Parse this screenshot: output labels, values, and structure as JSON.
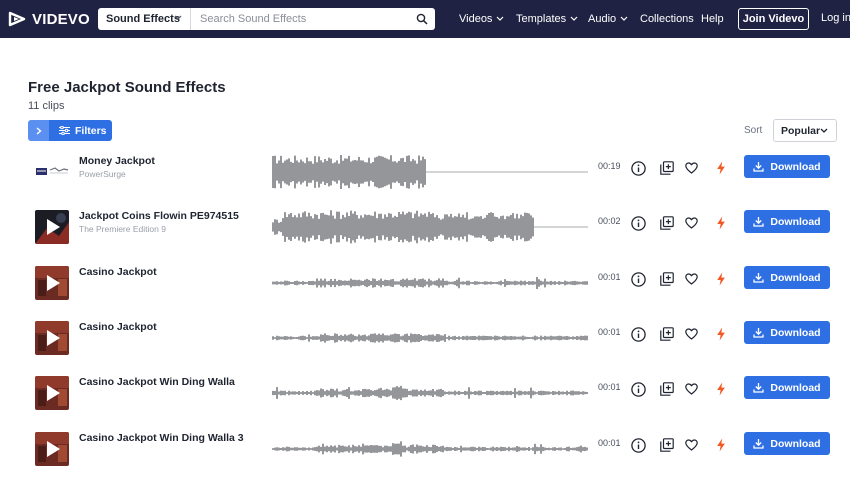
{
  "header": {
    "logo_text": "VIDEVO",
    "search": {
      "type_label": "Sound Effects",
      "placeholder": "Search Sound Effects"
    },
    "nav": [
      "Videos",
      "Templates",
      "Audio",
      "Collections",
      "Help"
    ],
    "join_label": "Join Videvo",
    "login_label": "Log in"
  },
  "page": {
    "title": "Free Jackpot Sound Effects",
    "clip_count": "11 clips",
    "filters_label": "Filters",
    "sort_label": "Sort",
    "sort_value": "Popular"
  },
  "colors": {
    "header_bg": "#1f2242",
    "accent_blue": "#2f6fe4",
    "bolt_orange": "#f05a22"
  },
  "tracks": [
    {
      "title": "Money Jackpot",
      "author": "PowerSurge",
      "duration": "00:19",
      "thumb": "powersurge-logo",
      "wave": "dense"
    },
    {
      "title": "Jackpot Coins Flowin PE974515",
      "author": "The Premiere Edition 9",
      "duration": "00:02",
      "thumb": "play-dark",
      "wave": "dense2"
    },
    {
      "title": "Casino Jackpot",
      "author": "",
      "duration": "00:01",
      "thumb": "play-red",
      "wave": "sparse"
    },
    {
      "title": "Casino Jackpot",
      "author": "",
      "duration": "00:01",
      "thumb": "play-red",
      "wave": "sparse"
    },
    {
      "title": "Casino Jackpot Win Ding Walla",
      "author": "",
      "duration": "00:01",
      "thumb": "play-red",
      "wave": "sparse2"
    },
    {
      "title": "Casino Jackpot Win Ding Walla 3",
      "author": "",
      "duration": "00:01",
      "thumb": "play-red",
      "wave": "sparse2"
    }
  ],
  "download_label": "Download",
  "row_icons": [
    "info-icon",
    "add-to-collection-icon",
    "heart-icon",
    "bolt-icon"
  ]
}
